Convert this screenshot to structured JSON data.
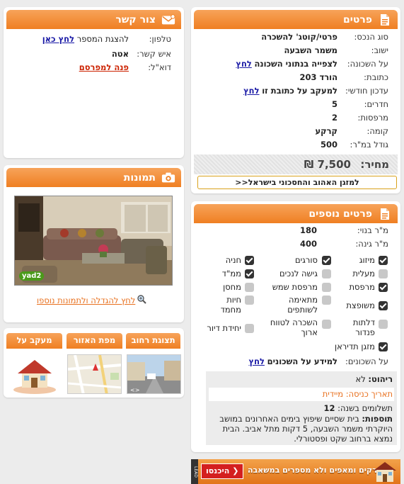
{
  "details": {
    "title": "פרטים",
    "rows": [
      {
        "label": "סוג הנכס:",
        "value": "פרטי/קוטג' להשכרה"
      },
      {
        "label": "ישוב:",
        "value": "משמר השבעה"
      },
      {
        "label": "על השכונה:",
        "value": "לצפייה בנתוני השכונה",
        "link": "לחץ"
      },
      {
        "label": "כתובת:",
        "value": "הורד 203"
      },
      {
        "label": "עדכון חודשי:",
        "value": "למעקב על כתובת זו",
        "link": "לחץ"
      },
      {
        "label": "חדרים:",
        "value": "5"
      },
      {
        "label": "מרפסות:",
        "value": "2"
      },
      {
        "label": "קומה:",
        "value": "קרקע"
      },
      {
        "label": "גודל במ\"ר:",
        "value": "500"
      }
    ],
    "price_label": "מחיר:",
    "price_value": "7,500 ₪",
    "mortgage_button": "למזגן האהוב והחסכוני בישראל<<"
  },
  "contact": {
    "title": "צור קשר",
    "phone_label": "טלפון:",
    "phone_text": "להצגת המספר",
    "phone_link": "לחץ כאן",
    "person_label": "איש קשר:",
    "person_value": "אטה",
    "email_label": "דוא\"ל:",
    "email_link": "פנה למפרסם"
  },
  "photos": {
    "title": "תמונות",
    "enlarge_link": "לחץ להגדלה ולתמונות נוספו",
    "watermark": "yad2"
  },
  "tabs": [
    "תצוגת רחוב",
    "מפת האזור",
    "מעקב על הנכס"
  ],
  "more": {
    "title": "פרטים נוספים",
    "built_label": "מ\"ר בנוי:",
    "built_value": "180",
    "garden_label": "מ\"ר גינה:",
    "garden_value": "400",
    "features": [
      {
        "name": "מיזוג",
        "on": true
      },
      {
        "name": "סורגים",
        "on": true
      },
      {
        "name": "חניה",
        "on": true
      },
      {
        "name": "מעלית",
        "on": false
      },
      {
        "name": "גישה לנכים",
        "on": false
      },
      {
        "name": "ממ\"ד",
        "on": true
      },
      {
        "name": "מרפסת",
        "on": true
      },
      {
        "name": "מרפסת שמש",
        "on": false
      },
      {
        "name": "מחסן",
        "on": false
      },
      {
        "name": "משופצת",
        "on": true
      },
      {
        "name": "מתאימה לשותפים",
        "on": false
      },
      {
        "name": "חיות מחמד",
        "on": false
      },
      {
        "name": "דלתות פנדור",
        "on": false
      },
      {
        "name": "השכרה לטווח ארוך",
        "on": false
      },
      {
        "name": "יחידת דיור",
        "on": false
      },
      {
        "name": "מזגן תדיראן",
        "on": true
      }
    ],
    "neighborhood_label": "על השכונים:",
    "neighborhood_text": "למידע על השכונים",
    "neighborhood_link": "לחץ",
    "furniture_label": "ריהוט:",
    "furniture_value": "לא",
    "entry_label": "תאריך כניסה:",
    "entry_value": "מיידית",
    "payments_label": "תשלומים בשנה:",
    "payments_value": "12",
    "additions_label": "תוספות:",
    "additions_text": "בית שסיים שיפוץ בימים האחרונים במושב היוקרתי משמר השבעה, 5 דקות מתל אביב. הבית נמצא ברחוב שקט ופסטורלי."
  },
  "banner": {
    "text": "בורקים ומאפים ולא מספרים במשאבה",
    "button": "היכנסו",
    "side": "LEAD"
  },
  "colors": {
    "accent": "#ef7f22",
    "link": "#1a1aa6",
    "alert": "#cc2200"
  }
}
